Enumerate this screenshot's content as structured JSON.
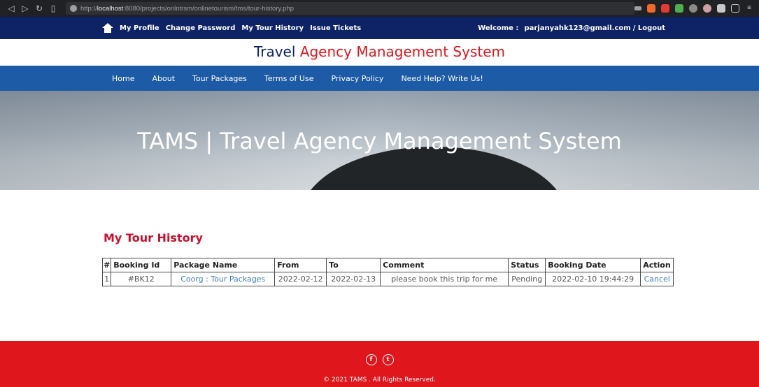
{
  "browser": {
    "url_prefix": "http://",
    "url_host": "localhost",
    "url_rest": ":8080/projects/onlntrsm/onlinetourism/tms/tour-history.php"
  },
  "top_bar": {
    "links": [
      "My Profile",
      "Change Password",
      "My Tour History",
      "Issue Tickets"
    ],
    "welcome_label": "Welcome :",
    "user_email": "parjanyahk123@gmail.com",
    "logout_label": "/ Logout"
  },
  "site_title": {
    "part1": "Travel",
    "part2": "Agency Management System"
  },
  "main_nav": [
    "Home",
    "About",
    "Tour Packages",
    "Terms of Use",
    "Privacy Policy",
    "Need Help?  Write Us!"
  ],
  "banner": {
    "text": "TAMS | Travel Agency Management System"
  },
  "history": {
    "title": "My Tour History",
    "columns": [
      "#",
      "Booking Id",
      "Package Name",
      "From",
      "To",
      "Comment",
      "Status",
      "Booking Date",
      "Action"
    ],
    "rows": [
      {
        "num": "1",
        "booking_id": "#BK12",
        "package_name": "Coorg : Tour Packages",
        "from": "2022-02-12",
        "to": "2022-02-13",
        "comment": "please book this trip for me",
        "status": "Pending",
        "booking_date": "2022-02-10 19:44:29",
        "action": "Cancel"
      }
    ]
  },
  "footer": {
    "copyright": "© 2021 TAMS . All Rights Reserved.",
    "social_icons": [
      "facebook-icon",
      "twitter-icon"
    ]
  },
  "colors": {
    "top_bar": "#0e2366",
    "nav": "#1d5ba6",
    "accent_red": "#e0161d",
    "heading_red": "#c8102e",
    "link_blue": "#3f7fbf"
  }
}
